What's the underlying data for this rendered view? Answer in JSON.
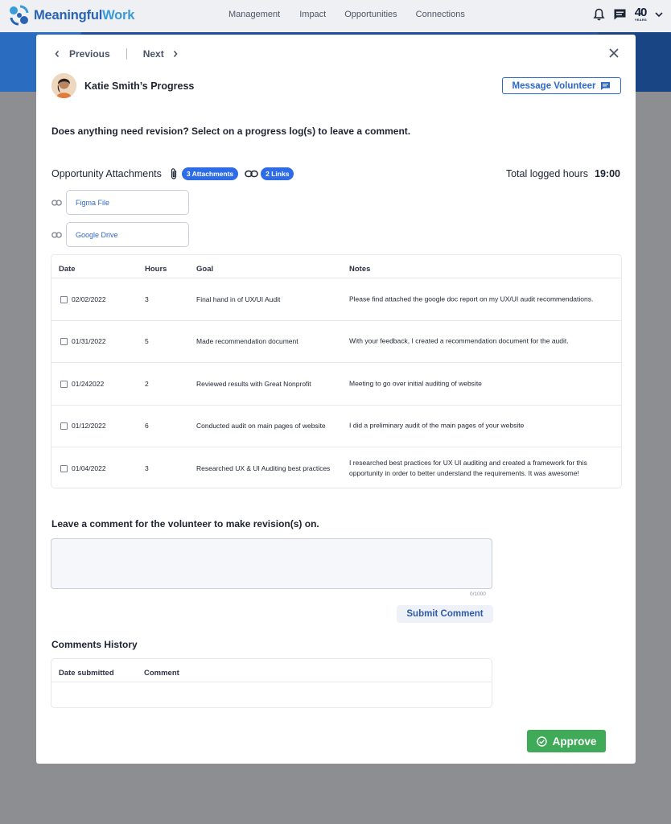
{
  "app": {
    "logo_part1": "Meaningful",
    "logo_part2": "Work",
    "badge": "40",
    "badge_sub": "YEARS"
  },
  "nav": {
    "items": [
      "Management",
      "Impact",
      "Opportunities",
      "Connections"
    ]
  },
  "modal": {
    "previous_label": "Previous",
    "next_label": "Next",
    "person_title": "Katie Smith’s Progress",
    "message_button": "Message Volunteer",
    "question": "Does anything need revision? Select on a progress log(s) to leave a comment.",
    "attachments_title": "Opportunity Attachments",
    "attachments_pill": "3 Attachments",
    "links_pill": "2 Links",
    "total_hours_label": "Total logged hours",
    "total_hours_value": "19:00",
    "links": [
      "Figma File",
      "Google Drive"
    ]
  },
  "log_table": {
    "headers": [
      "Date",
      "Hours",
      "Goal",
      "Notes"
    ],
    "rows": [
      {
        "date": "02/02/2022",
        "hours": "3",
        "goal": "Final hand in of UX/UI Audit",
        "notes": "Please find attached the google doc report on my UX/UI audit recommendations."
      },
      {
        "date": "01/31/2022",
        "hours": "5",
        "goal": "Made recommendation document",
        "notes": "With your feedback, I created a recommendation document for the audit."
      },
      {
        "date": "01/242022",
        "hours": "2",
        "goal": "Reviewed results with Great Nonprofit",
        "notes": "Meeting to go over initial auditing of website"
      },
      {
        "date": "01/12/2022",
        "hours": "6",
        "goal": "Conducted audit on main pages of website",
        "notes": "I did a preliminary audit of the main pages of your website"
      },
      {
        "date": "01/04/2022",
        "hours": "3",
        "goal": "Researched UX & UI Auditing best practices",
        "notes": "I researched best practices for UX UI auditing and created a framework for this opportunity in order to better understand the requirements. It was awesome!"
      }
    ]
  },
  "comment": {
    "label": "Leave a comment for the volunteer to make revision(s) on.",
    "value": "",
    "counter": "0/1000",
    "submit_label": "Submit Comment"
  },
  "history": {
    "title": "Comments History",
    "headers": [
      "Date submitted",
      "Comment"
    ]
  },
  "approve_label": "Approve",
  "colors": {
    "primary": "#2e68c5",
    "approve": "#3faa58",
    "pill": "#2e6be6"
  }
}
